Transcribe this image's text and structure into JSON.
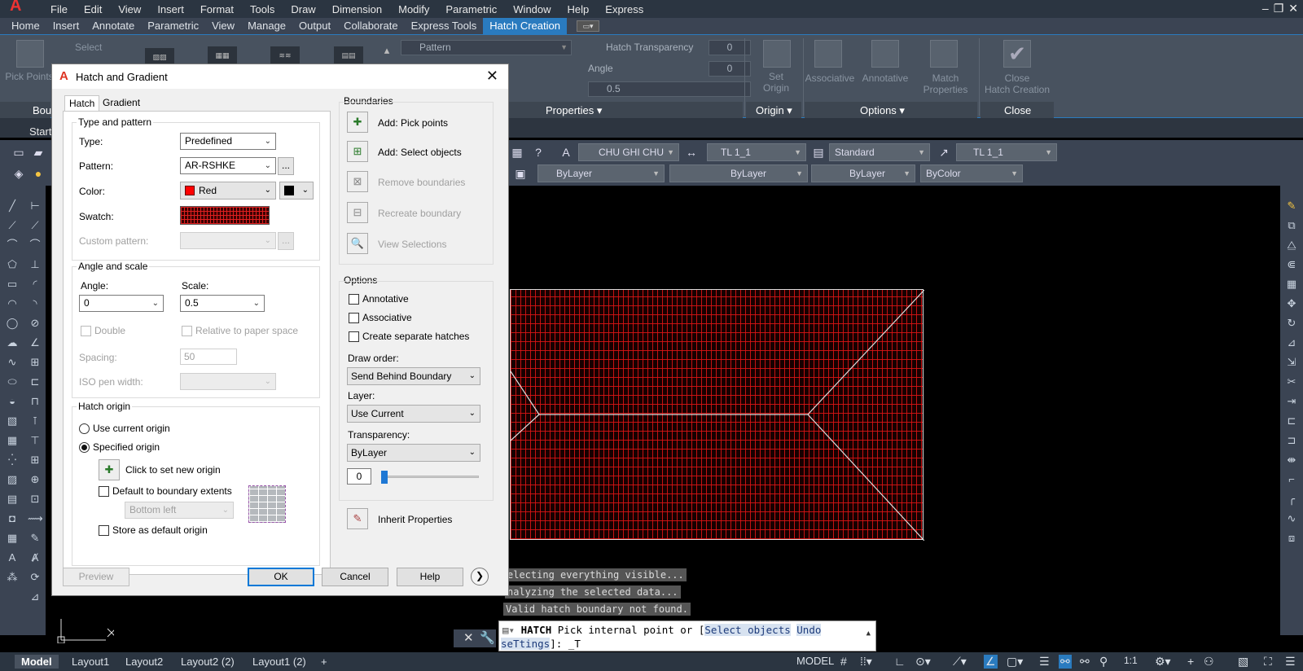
{
  "menubar": {
    "items": [
      "File",
      "Edit",
      "View",
      "Insert",
      "Format",
      "Tools",
      "Draw",
      "Dimension",
      "Modify",
      "Parametric",
      "Window",
      "Help",
      "Express"
    ]
  },
  "ribbon_tabs": {
    "items": [
      "Home",
      "Insert",
      "Annotate",
      "Parametric",
      "View",
      "Manage",
      "Output",
      "Collaborate",
      "Express Tools",
      "Hatch Creation"
    ],
    "active": "Hatch Creation"
  },
  "ribbon": {
    "pick_points": "Pick Points",
    "select": "Select",
    "boundaries_foot": "Bou",
    "pattern_combo": "Pattern",
    "hatch_transparency_label": "Hatch Transparency",
    "hatch_transparency_value": "0",
    "angle_label": "Angle",
    "angle_value": "0",
    "scale_value": "0.5",
    "properties_foot": "Properties ▾",
    "set_origin_line1": "Set",
    "set_origin_line2": "Origin",
    "origin_foot": "Origin ▾",
    "associative": "Associative",
    "annotative": "Annotative",
    "match_line1": "Match",
    "match_line2": "Properties",
    "options_foot": "Options ▾",
    "close_line1": "Close",
    "close_line2": "Hatch Creation",
    "close_foot": "Close"
  },
  "filetab": {
    "start": "Start"
  },
  "toolbar": {
    "text_style": "CHU GHI CHU",
    "dim_style": "TL 1_1",
    "table_style": "Standard",
    "mleader_style": "TL 1_1",
    "color": "ByLayer",
    "linetype": "ByLayer",
    "lineweight": "ByLayer",
    "plotstyle": "ByColor"
  },
  "dialog": {
    "title": "Hatch and Gradient",
    "tabs": {
      "hatch": "Hatch",
      "gradient": "Gradient"
    },
    "type_pattern": {
      "title": "Type and pattern",
      "type_label": "Type:",
      "type_value": "Predefined",
      "pattern_label": "Pattern:",
      "pattern_value": "AR-RSHKE",
      "color_label": "Color:",
      "color_value": "Red",
      "swatch_label": "Swatch:",
      "custom_label": "Custom pattern:",
      "dots": "..."
    },
    "angle_scale": {
      "title": "Angle and scale",
      "angle_label": "Angle:",
      "angle_value": "0",
      "scale_label": "Scale:",
      "scale_value": "0.5",
      "double": "Double",
      "relative": "Relative to paper space",
      "spacing_label": "Spacing:",
      "spacing_value": "50",
      "iso_label": "ISO pen width:"
    },
    "hatch_origin": {
      "title": "Hatch origin",
      "use_current": "Use current origin",
      "specified": "Specified origin",
      "click_new": "Click to set new origin",
      "default_extents": "Default to boundary extents",
      "extents_value": "Bottom left",
      "store_default": "Store as default origin"
    },
    "boundaries": {
      "title": "Boundaries",
      "add_pick": "Add: Pick points",
      "add_select": "Add: Select objects",
      "remove": "Remove boundaries",
      "recreate": "Recreate boundary",
      "view": "View Selections"
    },
    "options": {
      "title": "Options",
      "annotative": "Annotative",
      "associative": "Associative",
      "separate": "Create separate hatches",
      "draw_order_label": "Draw order:",
      "draw_order_value": "Send Behind Boundary",
      "layer_label": "Layer:",
      "layer_value": "Use Current",
      "transparency_label": "Transparency:",
      "transparency_value": "ByLayer",
      "transparency_number": "0",
      "transparency_level": 0.0
    },
    "inherit": "Inherit Properties",
    "buttons": {
      "preview": "Preview",
      "ok": "OK",
      "cancel": "Cancel",
      "help": "Help",
      "more": "❯"
    }
  },
  "command": {
    "history": [
      "electing everything visible...",
      "nalyzing the selected data...",
      "Valid hatch boundary not found."
    ],
    "prompt_cmd": "HATCH",
    "prompt_text": "Pick internal point or [",
    "opt_select": "Select objects",
    "opt_undo": "Undo",
    "opt_settings": "seTtings",
    "prompt_end": "]: _T"
  },
  "layout_tabs": {
    "items": [
      "Model",
      "Layout1",
      "Layout2",
      "Layout2 (2)",
      "Layout1 (2)"
    ],
    "add": "+"
  },
  "status": {
    "model": "MODEL",
    "scale": "1:1"
  },
  "colors": {
    "accent": "#2a7bbf",
    "hatch_red": "#d71414"
  }
}
